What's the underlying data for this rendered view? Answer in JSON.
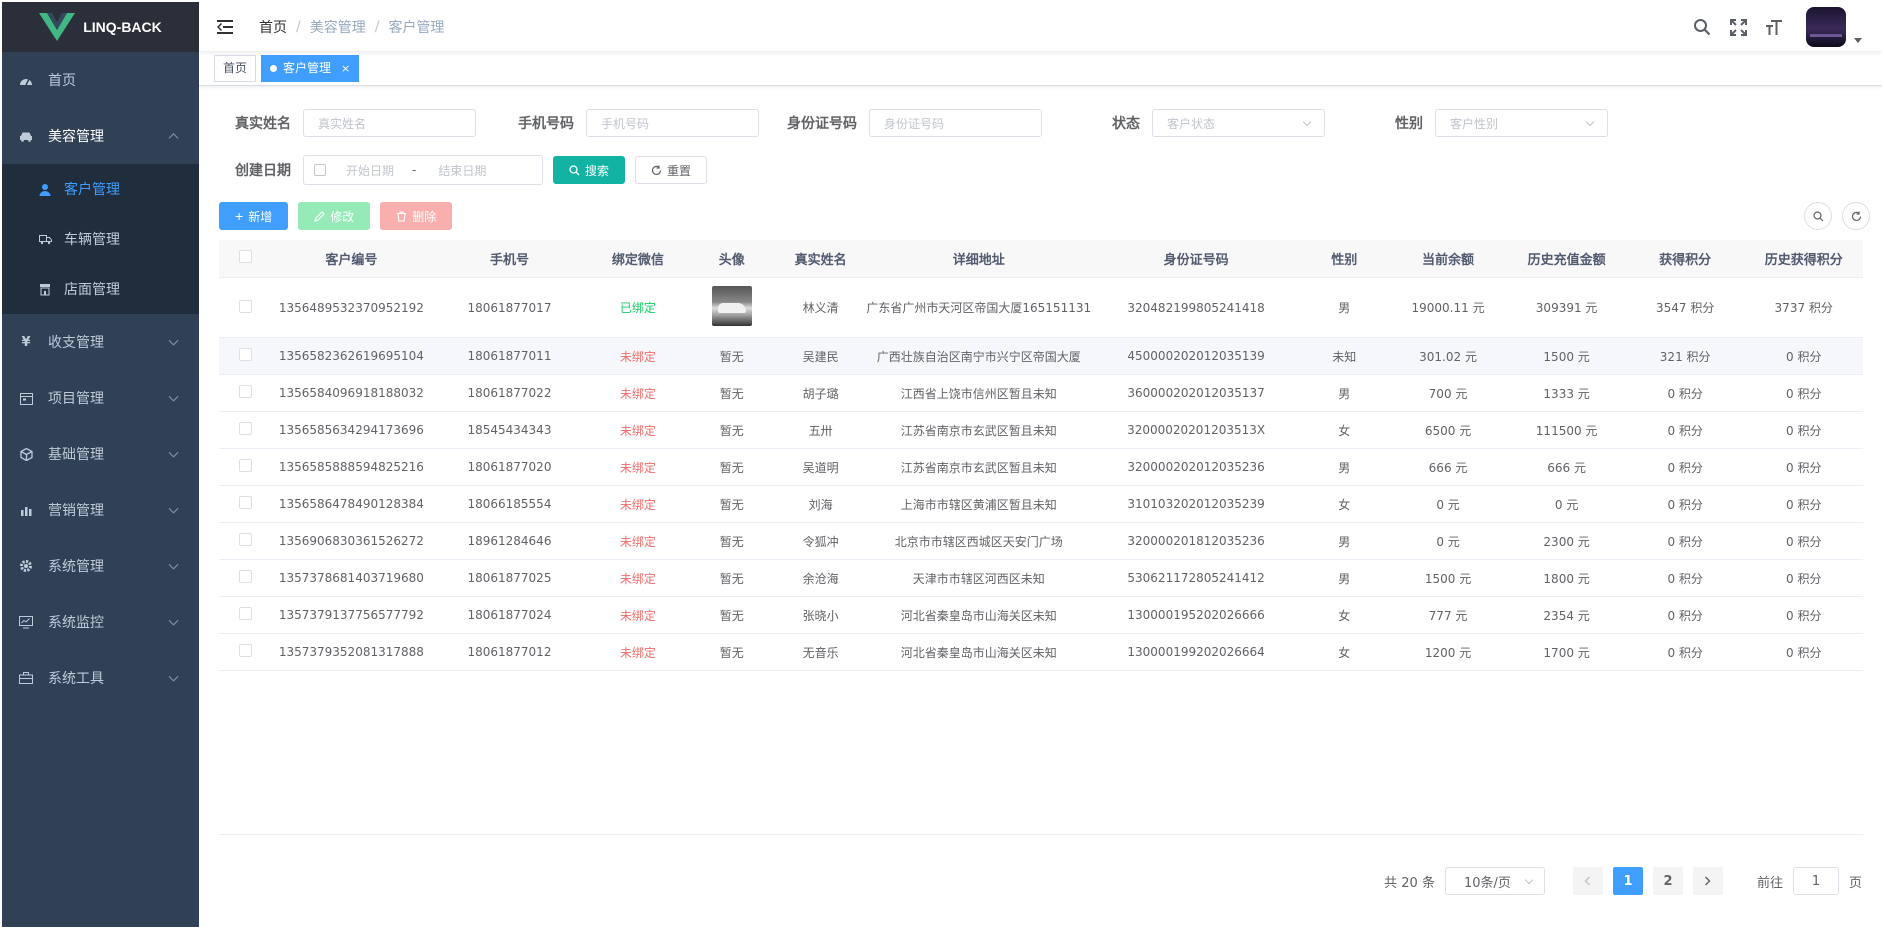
{
  "app": {
    "logo_text": "LINQ-BACK"
  },
  "sidebar": {
    "items": [
      {
        "label": "首页",
        "icon": "dashboard-icon"
      },
      {
        "label": "美容管理",
        "icon": "car-icon",
        "open": true,
        "children": [
          {
            "label": "客户管理",
            "icon": "user-icon",
            "active": true
          },
          {
            "label": "车辆管理",
            "icon": "truck-icon"
          },
          {
            "label": "店面管理",
            "icon": "store-icon"
          }
        ]
      },
      {
        "label": "收支管理",
        "icon": "yen-icon"
      },
      {
        "label": "项目管理",
        "icon": "calendar-icon"
      },
      {
        "label": "基础管理",
        "icon": "cube-icon"
      },
      {
        "label": "营销管理",
        "icon": "chart-icon"
      },
      {
        "label": "系统管理",
        "icon": "gear-icon"
      },
      {
        "label": "系统监控",
        "icon": "monitor-icon"
      },
      {
        "label": "系统工具",
        "icon": "toolbox-icon"
      }
    ]
  },
  "breadcrumb": [
    "首页",
    "美容管理",
    "客户管理"
  ],
  "tags": [
    {
      "label": "首页",
      "active": false
    },
    {
      "label": "客户管理",
      "active": true,
      "close": "×"
    }
  ],
  "search_form": {
    "real_name": {
      "label": "真实姓名",
      "placeholder": "真实姓名"
    },
    "phone": {
      "label": "手机号码",
      "placeholder": "手机号码"
    },
    "id_card": {
      "label": "身份证号码",
      "placeholder": "身份证号码"
    },
    "status": {
      "label": "状态",
      "placeholder": "客户状态"
    },
    "gender": {
      "label": "性别",
      "placeholder": "客户性别"
    },
    "created": {
      "label": "创建日期",
      "start_placeholder": "开始日期",
      "separator": "-",
      "end_placeholder": "结束日期"
    },
    "search_button": "搜索",
    "reset_button": "重置"
  },
  "toolbar": {
    "add": "新增",
    "edit": "修改",
    "delete": "删除"
  },
  "table": {
    "columns": [
      "客户编号",
      "手机号",
      "绑定微信",
      "头像",
      "真实姓名",
      "详细地址",
      "身份证号码",
      "性别",
      "当前余额",
      "历史充值金额",
      "获得积分",
      "历史获得积分"
    ],
    "rows": [
      {
        "id": "1356489532370952192",
        "phone": "18061877017",
        "wechat": "已绑定",
        "bound": true,
        "avatar": "photo",
        "name": "林义清",
        "address": "广东省广州市天河区帝国大厦165151131",
        "idcard": "320482199805241418",
        "gender": "男",
        "balance": "19000.11 元",
        "recharge": "309391 元",
        "points": "3547 积分",
        "hist_points": "3737 积分"
      },
      {
        "id": "1356582362619695104",
        "phone": "18061877011",
        "wechat": "未绑定",
        "bound": false,
        "avatar": "暂无",
        "name": "吴建民",
        "address": "广西壮族自治区南宁市兴宁区帝国大厦",
        "idcard": "450000202012035139",
        "gender": "未知",
        "balance": "301.02 元",
        "recharge": "1500 元",
        "points": "321 积分",
        "hist_points": "0 积分"
      },
      {
        "id": "1356584096918188032",
        "phone": "18061877022",
        "wechat": "未绑定",
        "bound": false,
        "avatar": "暂无",
        "name": "胡子璐",
        "address": "江西省上饶市信州区暂且未知",
        "idcard": "360000202012035137",
        "gender": "男",
        "balance": "700 元",
        "recharge": "1333 元",
        "points": "0 积分",
        "hist_points": "0 积分"
      },
      {
        "id": "1356585634294173696",
        "phone": "18545434343",
        "wechat": "未绑定",
        "bound": false,
        "avatar": "暂无",
        "name": "五卅",
        "address": "江苏省南京市玄武区暂且未知",
        "idcard": "32000020201203513X",
        "gender": "女",
        "balance": "6500 元",
        "recharge": "111500 元",
        "points": "0 积分",
        "hist_points": "0 积分"
      },
      {
        "id": "1356585888594825216",
        "phone": "18061877020",
        "wechat": "未绑定",
        "bound": false,
        "avatar": "暂无",
        "name": "吴道明",
        "address": "江苏省南京市玄武区暂且未知",
        "idcard": "320000202012035236",
        "gender": "男",
        "balance": "666 元",
        "recharge": "666 元",
        "points": "0 积分",
        "hist_points": "0 积分"
      },
      {
        "id": "1356586478490128384",
        "phone": "18066185554",
        "wechat": "未绑定",
        "bound": false,
        "avatar": "暂无",
        "name": "刘海",
        "address": "上海市市辖区黄浦区暂且未知",
        "idcard": "310103202012035239",
        "gender": "女",
        "balance": "0 元",
        "recharge": "0 元",
        "points": "0 积分",
        "hist_points": "0 积分"
      },
      {
        "id": "1356906830361526272",
        "phone": "18961284646",
        "wechat": "未绑定",
        "bound": false,
        "avatar": "暂无",
        "name": "令狐冲",
        "address": "北京市市辖区西城区天安门广场",
        "idcard": "320000201812035236",
        "gender": "男",
        "balance": "0 元",
        "recharge": "2300 元",
        "points": "0 积分",
        "hist_points": "0 积分"
      },
      {
        "id": "1357378681403719680",
        "phone": "18061877025",
        "wechat": "未绑定",
        "bound": false,
        "avatar": "暂无",
        "name": "余沧海",
        "address": "天津市市辖区河西区未知",
        "idcard": "530621172805241412",
        "gender": "男",
        "balance": "1500 元",
        "recharge": "1800 元",
        "points": "0 积分",
        "hist_points": "0 积分"
      },
      {
        "id": "1357379137756577792",
        "phone": "18061877024",
        "wechat": "未绑定",
        "bound": false,
        "avatar": "暂无",
        "name": "张晓小",
        "address": "河北省秦皇岛市山海关区未知",
        "idcard": "130000195202026666",
        "gender": "女",
        "balance": "777 元",
        "recharge": "2354 元",
        "points": "0 积分",
        "hist_points": "0 积分"
      },
      {
        "id": "1357379352081317888",
        "phone": "18061877012",
        "wechat": "未绑定",
        "bound": false,
        "avatar": "暂无",
        "name": "无音乐",
        "address": "河北省秦皇岛市山海关区未知",
        "idcard": "130000199202026664",
        "gender": "女",
        "balance": "1200 元",
        "recharge": "1700 元",
        "points": "0 积分",
        "hist_points": "0 积分"
      }
    ]
  },
  "pagination": {
    "total": "共 20 条",
    "page_size": "10条/页",
    "pages": [
      "1",
      "2"
    ],
    "current": "1",
    "goto_prefix": "前往",
    "goto_value": "1",
    "goto_suffix": "页"
  },
  "colors": {
    "sidebar_bg": "#304156",
    "submenu_bg": "#1f2d3d",
    "primary": "#409eff",
    "teal": "#13b3a4",
    "bound": "#13ce66",
    "unbound": "#f56c6c"
  }
}
